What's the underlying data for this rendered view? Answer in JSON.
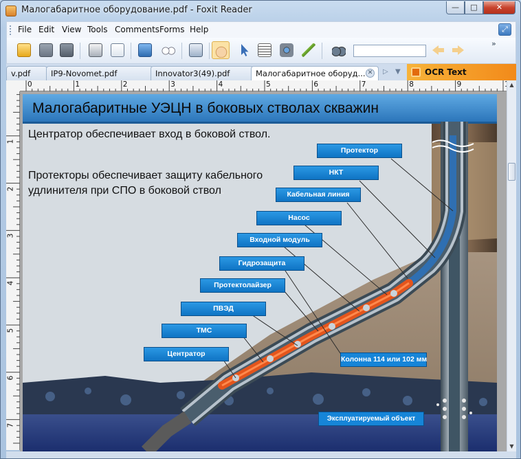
{
  "window": {
    "title": "Малогабаритное оборудование.pdf - Foxit Reader"
  },
  "menu": [
    "File",
    "Edit",
    "View",
    "Tools",
    "Comments",
    "Forms",
    "Help"
  ],
  "toolbar": {
    "buttons": [
      "open-folder",
      "save",
      "save-as",
      "print",
      "email",
      "fullscreen",
      "properties",
      "snapshot",
      "hand-tool",
      "select-tool",
      "text-select",
      "screenshot-tool",
      "typewriter",
      "find-binoculars",
      "previous-result",
      "next-result"
    ],
    "find_value": "",
    "more": "»"
  },
  "tabs": [
    "v.pdf",
    "IP9-Novomet.pdf",
    "Innovator3(49).pdf",
    "Малогабаритное оборуд..."
  ],
  "ocr_banner": "OCR Text Recognition",
  "ruler": {
    "h_marks": [
      "0",
      "1",
      "2",
      "3",
      "4",
      "5",
      "6",
      "7",
      "8",
      "9",
      "1"
    ],
    "v_marks": [
      "1",
      "2",
      "3",
      "4",
      "5",
      "6",
      "7"
    ]
  },
  "slide": {
    "heading": "Малогабаритные УЭЦН в боковых стволах скважин",
    "text1": "Центратор обеспечивает вход в боковой ствол.",
    "text2_line1": "Протекторы обеспечивает защиту кабельного",
    "text2_line2": "удлинителя  при СПО в боковой ствол",
    "text2_tail": ".",
    "labels": [
      "Протектор",
      "НКТ",
      "Кабельная линия",
      "Насос",
      "Входной модуль",
      "Гидрозащита",
      "Протектолайзер",
      "ПВЭД",
      "ТМС",
      "Центратор"
    ],
    "casing_label": "Колонна 114 или 102 мм",
    "object_label": "Эксплуатируемый объект"
  },
  "colors": {
    "label_bg": "#1685d8",
    "heading_bg": "#3d8fcf",
    "pump_orange": "#e4551c"
  }
}
